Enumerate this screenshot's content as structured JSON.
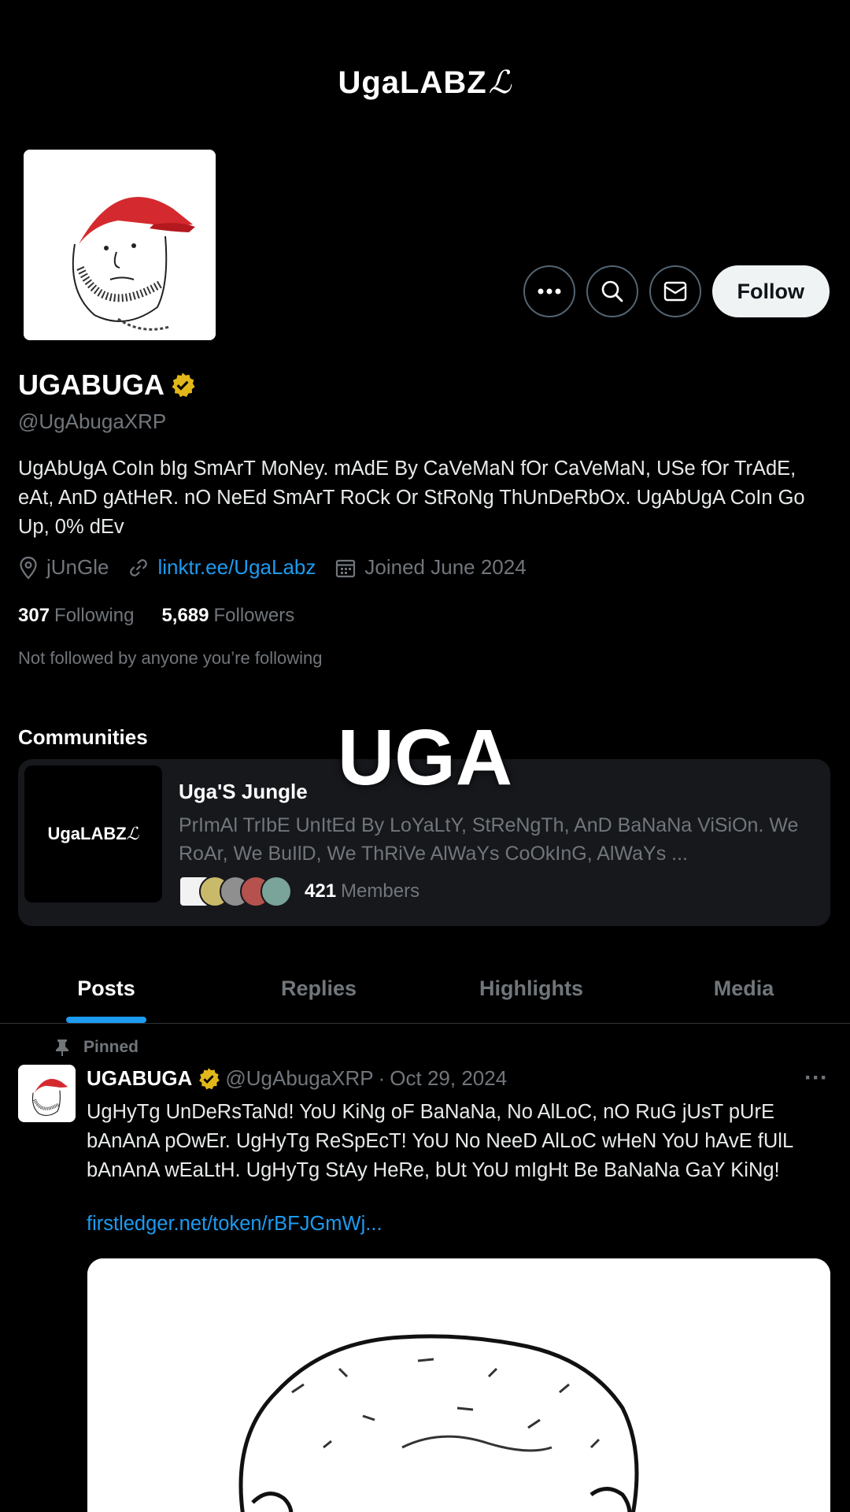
{
  "banner": {
    "logo_text": "UgaLABZ",
    "logo_mark": "ℒ"
  },
  "profile": {
    "name": "UGABUGA",
    "handle": "@UgAbugaXRP",
    "bio": "UgAbUgA CoIn bIg SmArT MoNey. mAdE By CaVeMaN fOr CaVeMaN, USe fOr TrAdE, eAt, AnD gAtHeR. nO NeEd SmArT RoCk Or StRoNg ThUnDeRbOx. UgAbUgA CoIn Go Up, 0% dEv",
    "location": "jUnGle",
    "link": "linktr.ee/UgaLabz",
    "joined": "Joined June 2024",
    "following_count": "307",
    "following_label": "Following",
    "followers_count": "5,689",
    "followers_label": "Followers",
    "not_followed_text": "Not followed by anyone you’re following"
  },
  "actions": {
    "follow_label": "Follow",
    "more_icon": "more-icon",
    "search_icon": "search-icon",
    "message_icon": "mail-icon"
  },
  "overlay_caption": "UGA",
  "communities": {
    "title": "Communities",
    "card": {
      "thumb_text": "UgaLABZ",
      "name": "Uga'S Jungle",
      "description": "PrImAl TrIbE UnItEd By LoYaLtY, StReNgTh, AnD BaNaNa ViSiOn. We RoAr, We BuIlD, We ThRiVe AlWaYs CoOkInG, AlWaYs ...",
      "members_count": "421",
      "members_label": "Members"
    }
  },
  "tabs": [
    {
      "label": "Posts"
    },
    {
      "label": "Replies"
    },
    {
      "label": "Highlights"
    },
    {
      "label": "Media"
    }
  ],
  "post": {
    "pinned_label": "Pinned",
    "name": "UGABUGA",
    "handle": "@UgAbugaXRP",
    "separator": "·",
    "date": "Oct 29, 2024",
    "more": "···",
    "text": "UgHyTg UnDeRsTaNd! YoU KiNg oF BaNaNa, No AlLoC, nO RuG jUsT pUrE bAnAnA pOwEr. UgHyTg ReSpEcT! YoU No NeeD AlLoC wHeN YoU hAvE fUlL bAnAnA wEaLtH. UgHyTg StAy HeRe, bUt YoU mIgHt Be BaNaNa GaY KiNg!",
    "link": "firstledger.net/token/rBFJGmWj..."
  },
  "colors": {
    "accent": "#1d9bf0",
    "verified": "#e2b719",
    "background": "#000000",
    "muted": "#71767b"
  }
}
